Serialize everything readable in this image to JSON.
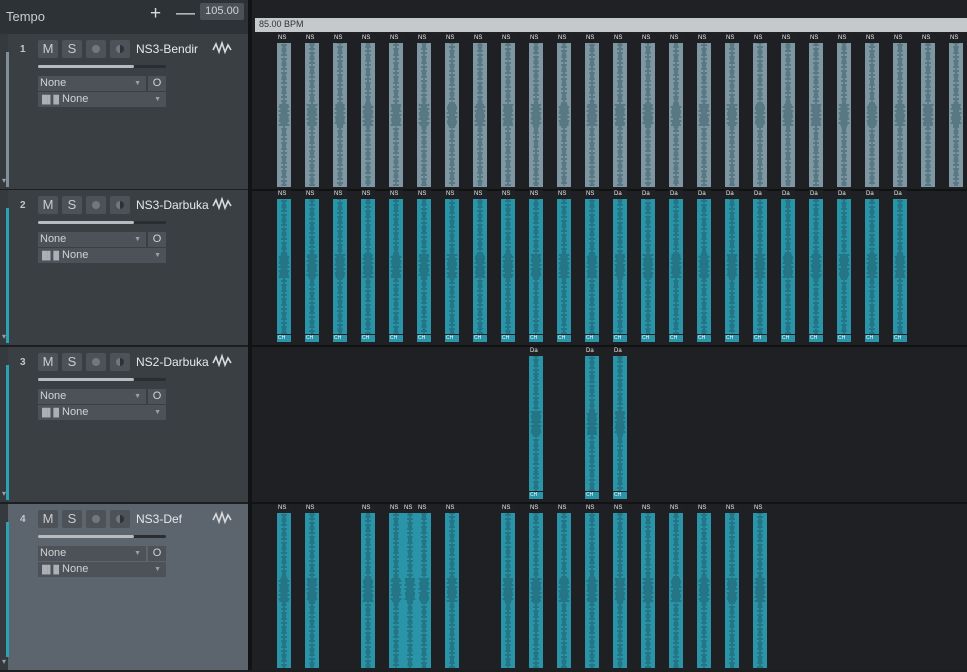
{
  "tempo": {
    "label": "Tempo",
    "plus": "+",
    "minus": "—",
    "value": "105.00",
    "bpm_label": "85.00 BPM"
  },
  "colors": {
    "teal": "#2a94a8",
    "grey": "#7f97a3",
    "accent_teal": "#2aa3b8"
  },
  "tracks": [
    {
      "num": "1",
      "name": "NS3-Bendir",
      "mute": "M",
      "solo": "S",
      "dropdown": "None",
      "dropdown_btn": "O",
      "instrument": "None",
      "clips": {
        "label": "NS",
        "columns": [
          0,
          1,
          2,
          3,
          4,
          5,
          6,
          7,
          8,
          9,
          10,
          11,
          12,
          13,
          14,
          15,
          16,
          17,
          18,
          19,
          20,
          21,
          22,
          23,
          24
        ],
        "color": "grey",
        "footers": []
      }
    },
    {
      "num": "2",
      "name": "NS3-Darbuka",
      "mute": "M",
      "solo": "S",
      "dropdown": "None",
      "dropdown_btn": "O",
      "instrument": "None",
      "clips": {
        "label": "NS",
        "columns": [
          0,
          1,
          2,
          3,
          4,
          5,
          6,
          7,
          8,
          9,
          10,
          11
        ],
        "label2": "Da",
        "columns2": [
          12,
          13,
          14,
          15,
          16,
          17,
          18,
          19,
          20,
          21,
          22
        ],
        "footer": "CH",
        "color": "teal"
      }
    },
    {
      "num": "3",
      "name": "NS2-Darbuka",
      "mute": "M",
      "solo": "S",
      "dropdown": "None",
      "dropdown_btn": "O",
      "instrument": "None",
      "clips": {
        "label": "Da",
        "columns": [
          9,
          11,
          12
        ],
        "footer": "CH",
        "color": "teal"
      }
    },
    {
      "num": "4",
      "name": "NS3-Def",
      "mute": "M",
      "solo": "S",
      "dropdown": "None",
      "dropdown_btn": "O",
      "instrument": "None",
      "clips": {
        "label": "NS",
        "columns": [
          0,
          1,
          3,
          4,
          4.5,
          5,
          6,
          8,
          9,
          10,
          11,
          12,
          13,
          14,
          15,
          16,
          17
        ],
        "color": "teal"
      }
    }
  ]
}
